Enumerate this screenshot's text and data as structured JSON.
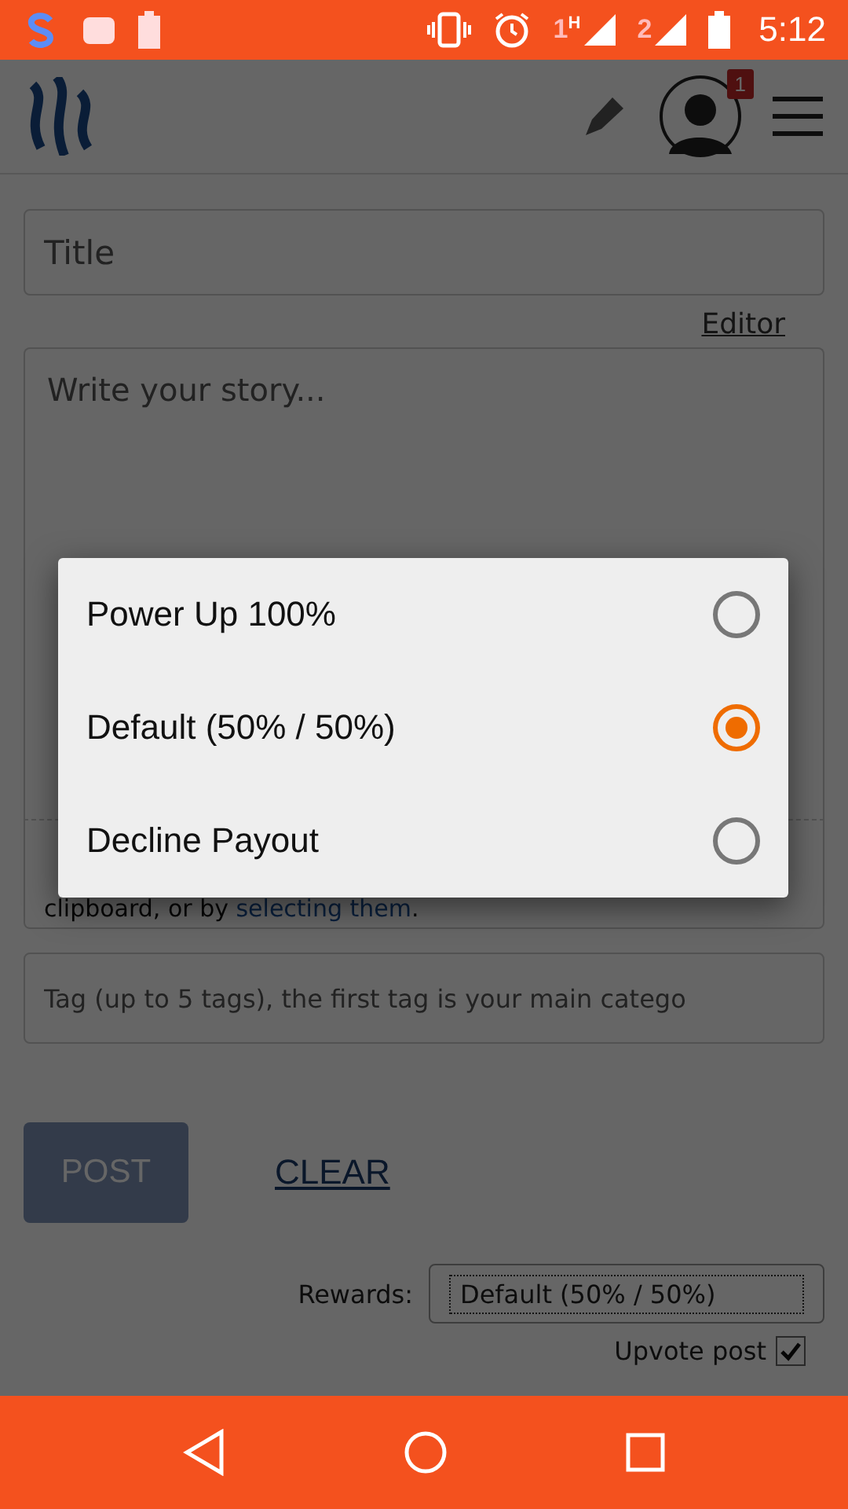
{
  "status_bar": {
    "sims": [
      {
        "label": "1",
        "network": "H"
      },
      {
        "label": "2"
      }
    ],
    "time": "5:12"
  },
  "header": {
    "notification_count": "1"
  },
  "form": {
    "title": {
      "placeholder": "Title"
    },
    "editor_link": "Editor",
    "story": {
      "placeholder": "Write your story..."
    },
    "hint": {
      "line_2": "clipboard, or by ",
      "link": "selecting them",
      "line_2_end": "."
    },
    "tags": {
      "placeholder": "Tag (up to 5 tags), the first tag is your main catego"
    },
    "post_button": {
      "label": "POST",
      "disabled": true
    },
    "clear_link": "CLEAR",
    "rewards": {
      "label": "Rewards:",
      "value": "Default (50% / 50%)"
    },
    "upvote": {
      "label": "Upvote post",
      "checked": true
    }
  },
  "dialog": {
    "options": [
      {
        "label": "Power Up 100%",
        "selected": false
      },
      {
        "label": "Default (50% / 50%)",
        "selected": true
      },
      {
        "label": "Decline Payout",
        "selected": false
      }
    ]
  }
}
